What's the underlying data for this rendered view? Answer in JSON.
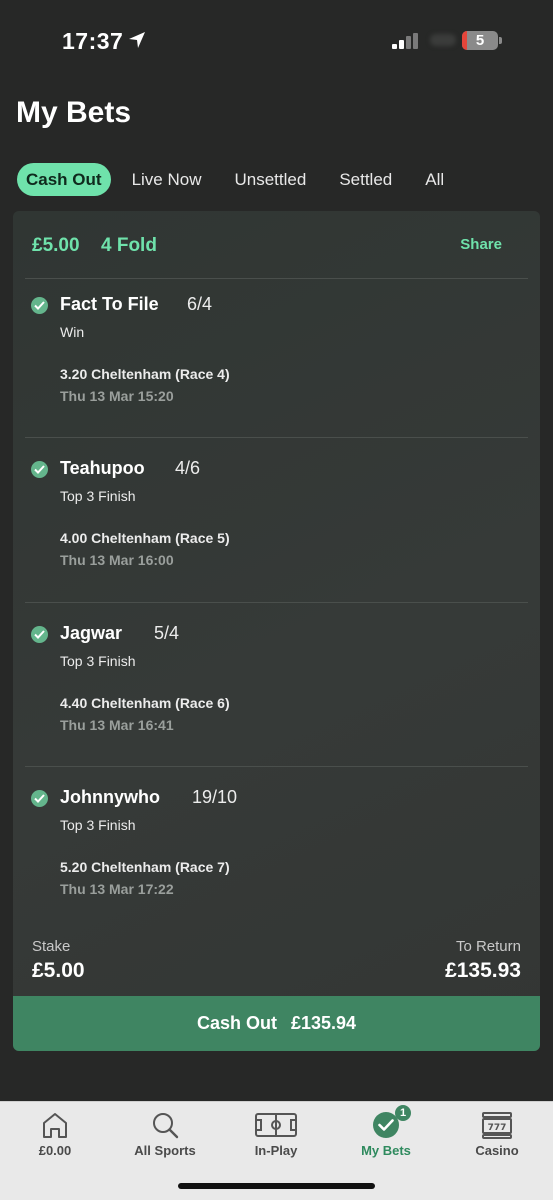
{
  "status_bar": {
    "time": "17:37",
    "battery": "5"
  },
  "page": {
    "title": "My Bets"
  },
  "tabs": [
    {
      "label": "Cash Out",
      "active": true
    },
    {
      "label": "Live Now",
      "active": false
    },
    {
      "label": "Unsettled",
      "active": false
    },
    {
      "label": "Settled",
      "active": false
    },
    {
      "label": "All",
      "active": false
    }
  ],
  "bet": {
    "stake_header": "£5.00",
    "bet_type": "4 Fold",
    "share_label": "Share",
    "selections": [
      {
        "name": "Fact To File",
        "odds": "6/4",
        "market": "Win",
        "event": "3.20 Cheltenham (Race 4)",
        "date": "Thu 13 Mar 15:20"
      },
      {
        "name": "Teahupoo",
        "odds": "4/6",
        "market": "Top 3 Finish",
        "event": "4.00 Cheltenham (Race 5)",
        "date": "Thu 13 Mar 16:00"
      },
      {
        "name": "Jagwar",
        "odds": "5/4",
        "market": "Top 3 Finish",
        "event": "4.40 Cheltenham (Race 6)",
        "date": "Thu 13 Mar 16:41"
      },
      {
        "name": "Johnnywho",
        "odds": "19/10",
        "market": "Top 3 Finish",
        "event": "5.20 Cheltenham (Race 7)",
        "date": "Thu 13 Mar 17:22"
      }
    ],
    "stake_label": "Stake",
    "stake_value": "£5.00",
    "return_label": "To Return",
    "return_value": "£135.93",
    "cashout_label": "Cash Out",
    "cashout_value": "£135.94"
  },
  "bottom_nav": {
    "items": [
      {
        "label": "£0.00",
        "icon": "home-icon"
      },
      {
        "label": "All Sports",
        "icon": "search-icon"
      },
      {
        "label": "In-Play",
        "icon": "pitch-icon"
      },
      {
        "label": "My Bets",
        "icon": "check-circle-icon",
        "badge": "1"
      },
      {
        "label": "Casino",
        "icon": "slot-machine-icon"
      }
    ]
  },
  "colors": {
    "accent": "#6fe2ab",
    "background": "#272827",
    "card": "#333735",
    "cashout_button": "#3f8562",
    "nav_active": "#2f8a5e"
  }
}
